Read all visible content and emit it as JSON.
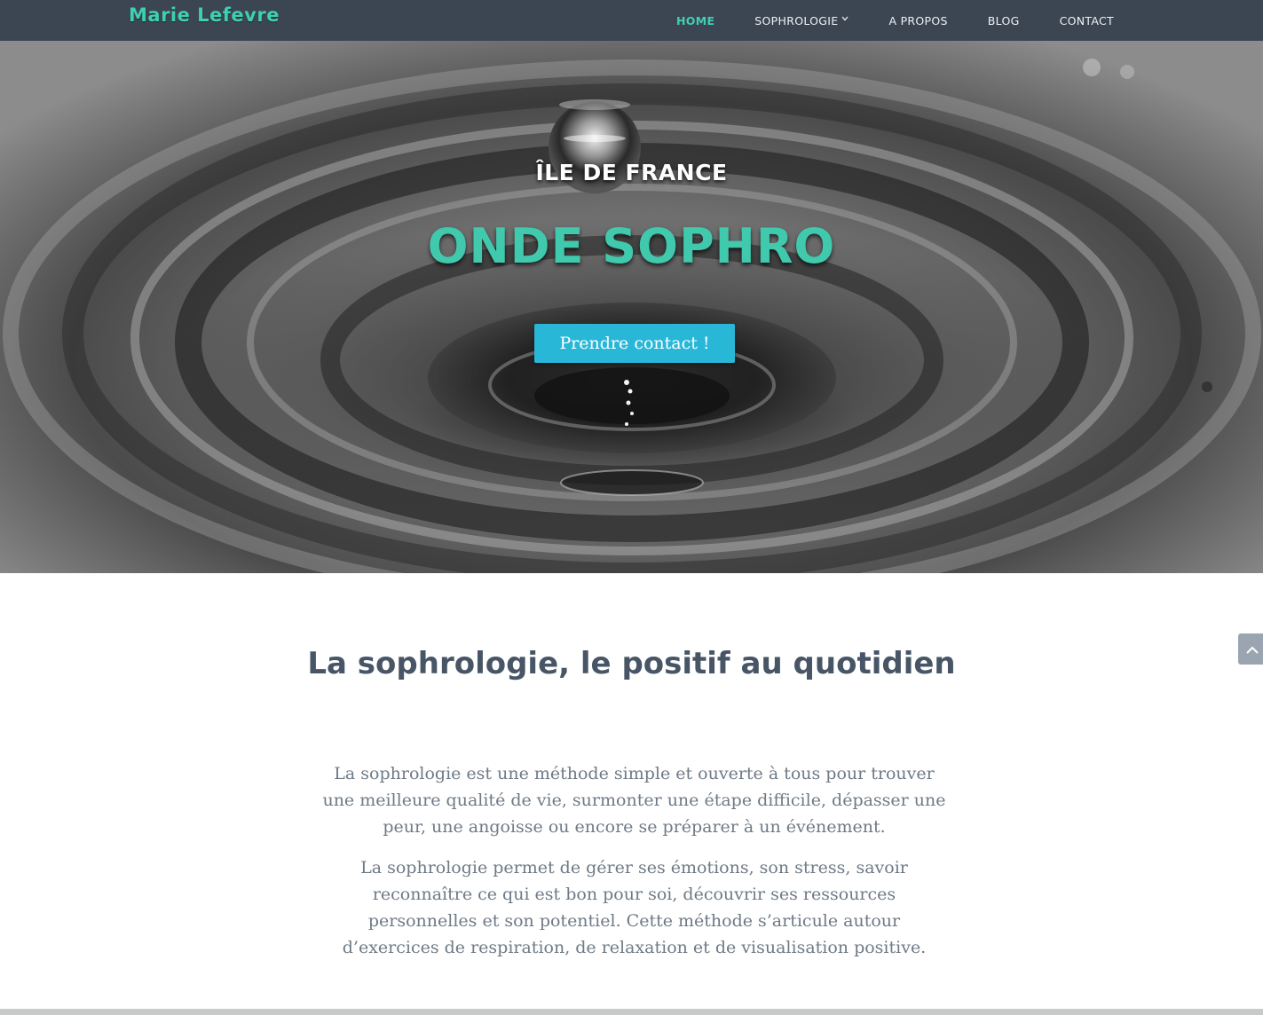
{
  "header": {
    "brand": "Marie Lefevre",
    "nav": [
      {
        "label": "HOME",
        "active": true
      },
      {
        "label": "SOPHROLOGIE",
        "has_dropdown": true
      },
      {
        "label": "A PROPOS"
      },
      {
        "label": "BLOG"
      },
      {
        "label": "CONTACT"
      }
    ]
  },
  "hero": {
    "subtitle": "ÎLE DE FRANCE",
    "title": "ONDE SOPHRO",
    "cta_label": "Prendre contact !"
  },
  "main": {
    "heading": "La sophrologie, le positif au quotidien",
    "paragraphs": [
      "La sophrologie est une méthode simple et ouverte à tous pour trouver une meilleure qualité de vie, surmonter une étape difficile, dépasser une peur, une angoisse ou encore se préparer à un événement.",
      "La sophrologie permet de gérer ses émotions, son stress, savoir reconnaître ce qui est bon pour soi, découvrir ses ressources personnelles et son potentiel. Cette méthode s’articule autour d’exercices de respiration, de relaxation et de visualisation positive."
    ]
  },
  "icons": {
    "dropdown": "chevron-down-icon",
    "scroll_top": "chevron-up-icon"
  },
  "colors": {
    "accent": "#3fcfb2",
    "navbar_bg": "#3b4652",
    "button_bg": "#29b7d8",
    "heading": "#475566",
    "body_text": "#6f7a86"
  }
}
